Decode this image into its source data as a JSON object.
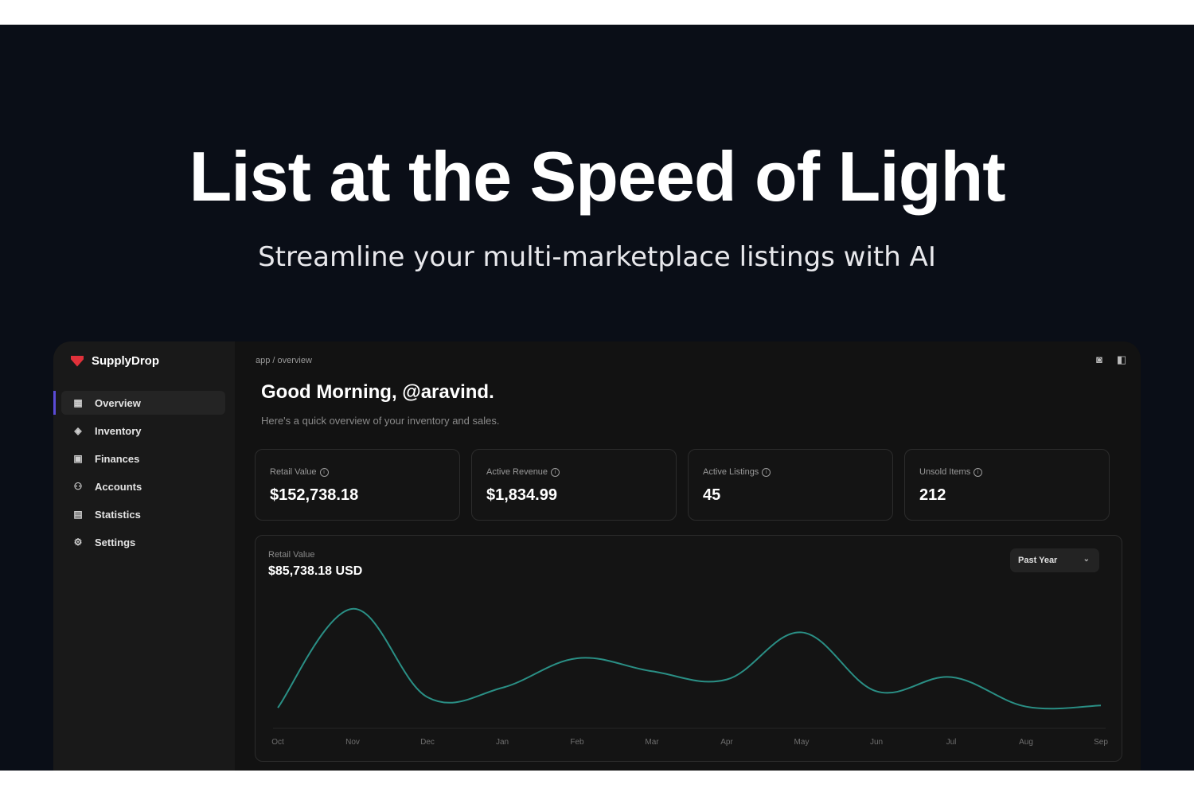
{
  "hero": {
    "headline": "List at the Speed of Light",
    "subheadline": "Streamline your multi-marketplace listings with AI"
  },
  "app": {
    "brand": "SupplyDrop",
    "nav": [
      {
        "label": "Overview",
        "icon": "grid-icon",
        "active": true
      },
      {
        "label": "Inventory",
        "icon": "gem-icon",
        "active": false
      },
      {
        "label": "Finances",
        "icon": "wallet-icon",
        "active": false
      },
      {
        "label": "Accounts",
        "icon": "user-icon",
        "active": false
      },
      {
        "label": "Statistics",
        "icon": "chart-icon",
        "active": false
      },
      {
        "label": "Settings",
        "icon": "gear-icon",
        "active": false
      }
    ],
    "breadcrumb": "app / overview",
    "greeting": "Good Morning, @aravind.",
    "greeting_sub": "Here's a quick overview of your inventory and sales.",
    "cards": [
      {
        "label": "Retail Value",
        "value": "$152,738.18"
      },
      {
        "label": "Active Revenue",
        "value": "$1,834.99"
      },
      {
        "label": "Active Listings",
        "value": "45"
      },
      {
        "label": "Unsold Items",
        "value": "212"
      }
    ],
    "chart_panel": {
      "label": "Retail Value",
      "total": "$85,738.18 USD",
      "range": "Past Year"
    },
    "accent": "#2a8f85"
  },
  "chart_data": {
    "type": "line",
    "categories": [
      "Oct",
      "Nov",
      "Dec",
      "Jan",
      "Feb",
      "Mar",
      "Apr",
      "May",
      "Jun",
      "Jul",
      "Aug",
      "Sep"
    ],
    "values": [
      0.08,
      0.92,
      0.17,
      0.25,
      0.5,
      0.39,
      0.32,
      0.72,
      0.22,
      0.34,
      0.09,
      0.1
    ],
    "ylim": [
      0,
      1
    ],
    "grid": false,
    "color": "#2a8f85"
  }
}
